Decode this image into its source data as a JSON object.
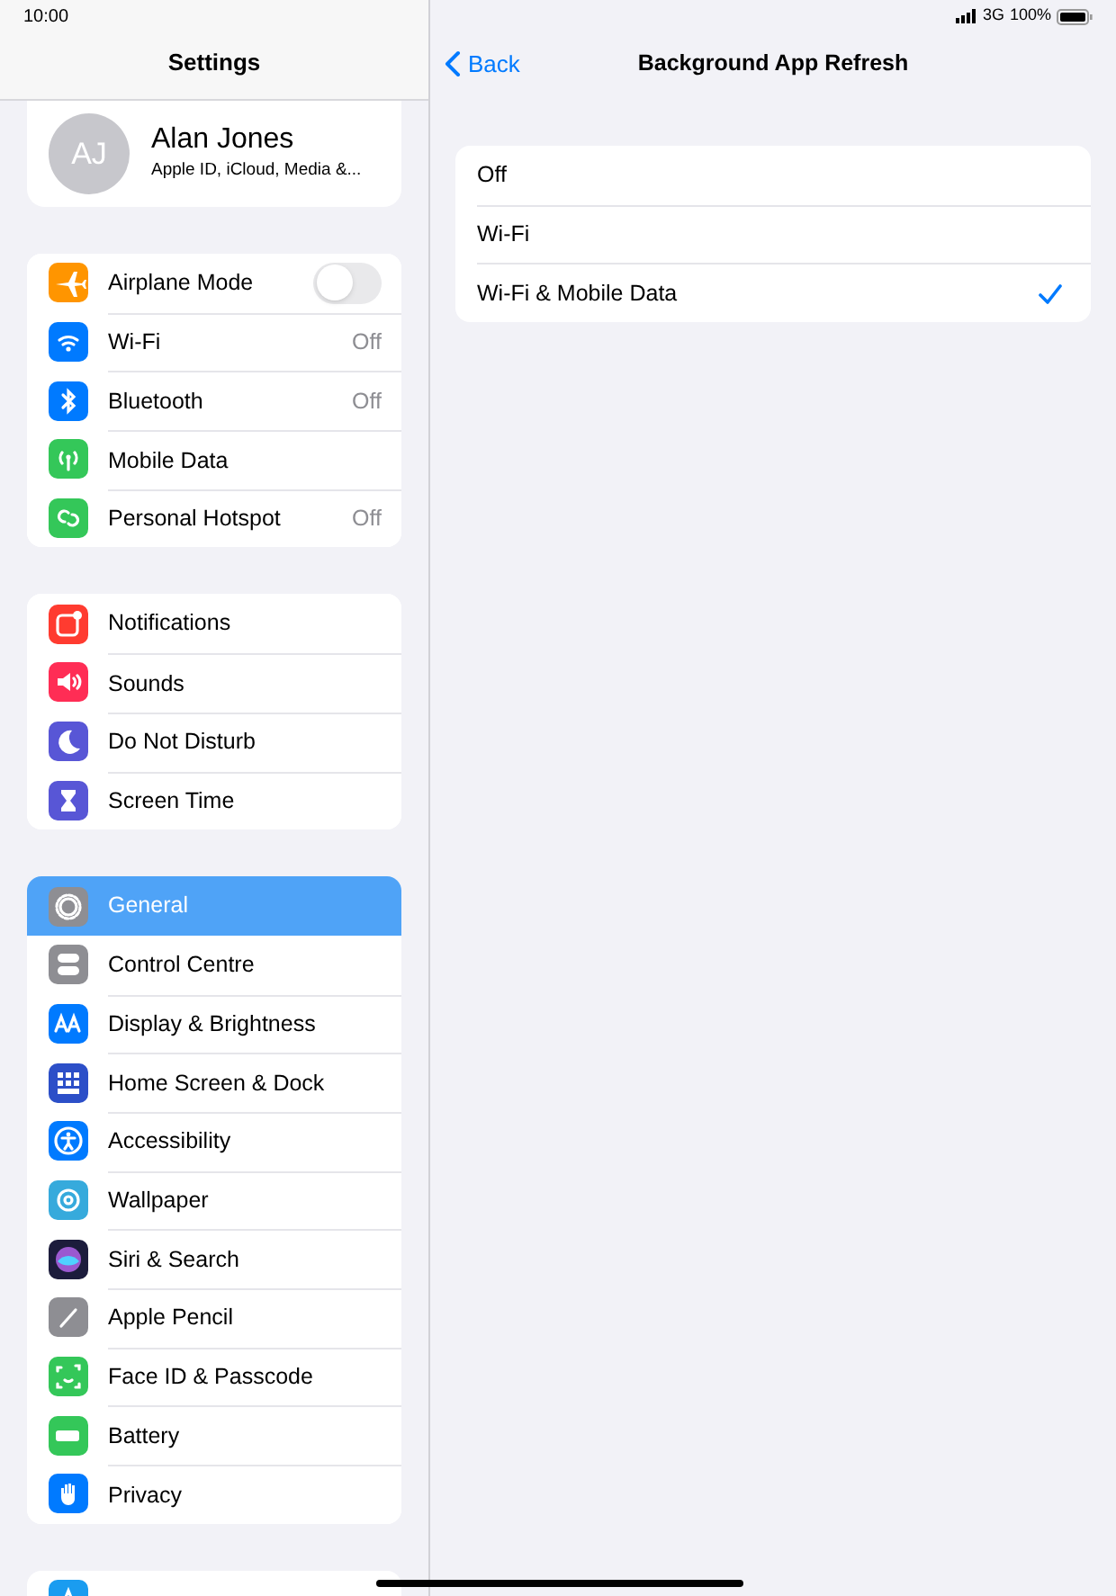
{
  "status_bar": {
    "time": "10:00",
    "network": "3G",
    "battery": "100%"
  },
  "sidebar": {
    "title": "Settings",
    "profile": {
      "initials": "AJ",
      "name": "Alan Jones",
      "subtitle": "Apple ID, iCloud, Media &..."
    },
    "groups": [
      {
        "items": [
          {
            "label": "Airplane Mode",
            "kind": "toggle",
            "on": false,
            "color": "#ff9500",
            "selected": false
          },
          {
            "label": "Wi-Fi",
            "kind": "value",
            "value": "Off",
            "color": "#007aff",
            "selected": false
          },
          {
            "label": "Bluetooth",
            "kind": "value",
            "value": "Off",
            "color": "#007aff",
            "selected": false
          },
          {
            "label": "Mobile Data",
            "kind": "plain",
            "color": "#34c759",
            "selected": false
          },
          {
            "label": "Personal Hotspot",
            "kind": "value",
            "value": "Off",
            "color": "#34c759",
            "selected": false
          }
        ]
      },
      {
        "items": [
          {
            "label": "Notifications",
            "kind": "plain",
            "color": "#ff3b30",
            "selected": false
          },
          {
            "label": "Sounds",
            "kind": "plain",
            "color": "#ff2d55",
            "selected": false
          },
          {
            "label": "Do Not Disturb",
            "kind": "plain",
            "color": "#5856d6",
            "selected": false
          },
          {
            "label": "Screen Time",
            "kind": "plain",
            "color": "#5856d6",
            "selected": false
          }
        ]
      },
      {
        "items": [
          {
            "label": "General",
            "kind": "plain",
            "color": "#8e8e93",
            "selected": true
          },
          {
            "label": "Control Centre",
            "kind": "plain",
            "color": "#8e8e93",
            "selected": false
          },
          {
            "label": "Display & Brightness",
            "kind": "plain",
            "color": "#007aff",
            "selected": false
          },
          {
            "label": "Home Screen & Dock",
            "kind": "plain",
            "color": "#2c4fc8",
            "selected": false
          },
          {
            "label": "Accessibility",
            "kind": "plain",
            "color": "#007aff",
            "selected": false
          },
          {
            "label": "Wallpaper",
            "kind": "plain",
            "color": "#36aadc",
            "selected": false
          },
          {
            "label": "Siri & Search",
            "kind": "plain",
            "color": "#1c1c3c",
            "selected": false
          },
          {
            "label": "Apple Pencil",
            "kind": "plain",
            "color": "#8e8e93",
            "selected": false
          },
          {
            "label": "Face ID & Passcode",
            "kind": "plain",
            "color": "#34c759",
            "selected": false
          },
          {
            "label": "Battery",
            "kind": "plain",
            "color": "#34c759",
            "selected": false
          },
          {
            "label": "Privacy",
            "kind": "plain",
            "color": "#007aff",
            "selected": false
          }
        ]
      },
      {
        "items": [
          {
            "kind": "plain",
            "color": "#1a9cf0",
            "selected": false
          }
        ]
      }
    ]
  },
  "detail": {
    "back": "Back",
    "title": "Background App Refresh",
    "options": [
      {
        "label": "Off",
        "selected": false
      },
      {
        "label": "Wi-Fi",
        "selected": false
      },
      {
        "label": "Wi-Fi & Mobile Data",
        "selected": true
      }
    ]
  }
}
